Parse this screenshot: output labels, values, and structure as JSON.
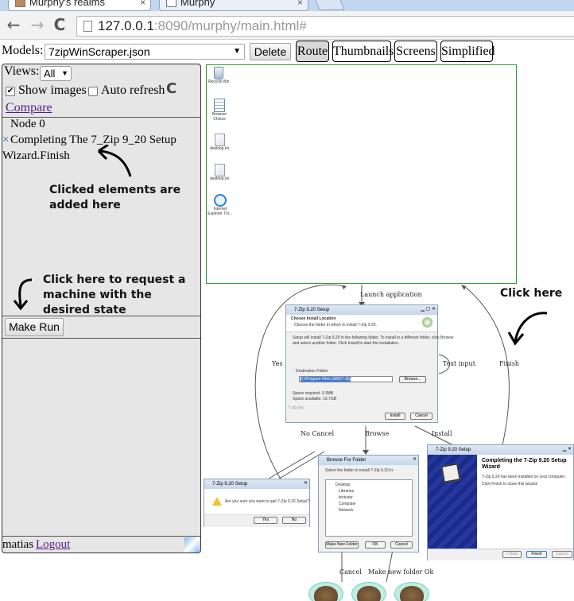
{
  "browser": {
    "tabs": [
      {
        "title": "Murphy's realms"
      },
      {
        "title": "Murphy"
      }
    ],
    "url_host": "127.0.0.1",
    "url_rest": ":8090/murphy/main.html#",
    "back_glyph": "←",
    "forward_glyph": "→",
    "reload_glyph": "C",
    "close_glyph": "×"
  },
  "top": {
    "models_label": "Models:",
    "model_selected": "7zipWinScraper.json",
    "delete_label": "Delete",
    "view_buttons": [
      "Route",
      "Thumbnails",
      "Screens",
      "Simplified"
    ]
  },
  "panel": {
    "views_label": "Views:",
    "views_selected": "All",
    "show_images_label": "Show images",
    "auto_refresh_label": "Auto refresh",
    "compare_label": "Compare",
    "node_label": "Node 0",
    "step_remove_glyph": "×",
    "step_line1": "Completing The 7_Zip 9_20 Setup",
    "step_line2": "Wizard.Finish",
    "make_run_label": "Make Run",
    "user_name": "matias",
    "logout_label": "Logout"
  },
  "annotations": {
    "clicked": [
      "Clicked elements are",
      "added here"
    ],
    "request": [
      "Click here to request a",
      "machine with the",
      "desired state"
    ],
    "click_here": "Click here"
  },
  "graph": {
    "desktop_icons": [
      {
        "label": "Recycle Bin"
      },
      {
        "label": "Browser Choice"
      },
      {
        "label": "desktop.ini"
      },
      {
        "label": "desktop.ini"
      },
      {
        "label": "Internet Explorer Tro..."
      }
    ],
    "edges": {
      "launch": "Launch application",
      "text_input": "Text input",
      "finish": "Finish",
      "yes": "Yes",
      "no_cancel": "No Cancel",
      "browse": "Browse",
      "install": "Install",
      "cancel": "Cancel",
      "make_new_folder_ok": "Make new folder Ok"
    },
    "install_dialog": {
      "title": "7-Zip 9.20 Setup",
      "heading": "Choose Install Location",
      "sub": "Choose the folder in which to install 7-Zip 9.20.",
      "body1": "Setup will install 7-Zip 9.20 in the following folder. To install in a different folder, click Browse",
      "body2": "and select another folder. Click Install to start the installation.",
      "dest_label": "Destination Folder",
      "dest_value": "C:\\Program Files (x86)\\7-Zip",
      "browse": "Browse...",
      "space_req": "Space required: 3.3MB",
      "space_avail": "Space available: 10.7GB",
      "footer": "7-zip.org",
      "install": "Install",
      "cancel": "Cancel"
    },
    "quit_dialog": {
      "title": "7-Zip 9.20 Setup",
      "question": "Are you sure you want to quit 7-Zip 9.20 Setup?",
      "yes": "Yes",
      "no": "No"
    },
    "browse_dialog": {
      "title": "Browse For Folder",
      "prompt": "Select the folder to install 7-Zip 9.20 in:",
      "items": [
        "Desktop",
        "Libraries",
        "testuser",
        "Computer",
        "Network"
      ],
      "make_new": "Make New Folder",
      "ok": "OK",
      "cancel": "Cancel"
    },
    "finish_dialog": {
      "title": "7-Zip 9.20 Setup",
      "heading1": "Completing the 7-Zip 9.20 Setup",
      "heading2": "Wizard",
      "line1": "7-Zip 9.20 has been installed on your computer.",
      "line2": "Click Finish to close this wizard.",
      "back": "< Back",
      "finish": "Finish",
      "cancel": "Cancel"
    }
  },
  "colors": {
    "node_border": "#2e9b2e",
    "edge": "#555555",
    "wizard_blue": "#1a2b8c",
    "link": "#551a8b"
  }
}
